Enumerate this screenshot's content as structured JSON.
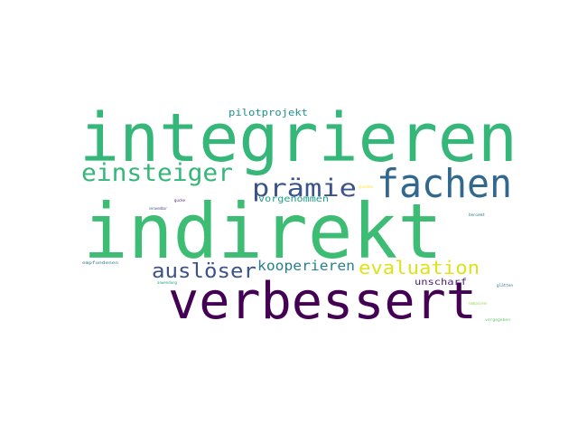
{
  "words": [
    {
      "id": "integrieren",
      "text": "integrieren",
      "color": "#35b779"
    },
    {
      "id": "indirekt",
      "text": "indirekt",
      "color": "#3dbc74"
    },
    {
      "id": "verbessert",
      "text": "verbessert",
      "color": "#440154"
    },
    {
      "id": "fachen",
      "text": "fachen",
      "color": "#31688e"
    },
    {
      "id": "einsteiger",
      "text": "einsteiger",
      "color": "#35b779"
    },
    {
      "id": "praemie",
      "text": "prämie",
      "color": "#3b528b"
    },
    {
      "id": "ausloeser",
      "text": "auslöser",
      "color": "#3b528b"
    },
    {
      "id": "evaluation",
      "text": "evaluation",
      "color": "#dde318"
    },
    {
      "id": "kooperieren",
      "text": "kooperieren",
      "color": "#26828e"
    },
    {
      "id": "pilotprojekt",
      "text": "pilotprojekt",
      "color": "#21918c"
    },
    {
      "id": "vorgenommen",
      "text": "vorgenommen",
      "color": "#1fa187"
    },
    {
      "id": "unscharf",
      "text": "unscharf",
      "color": "#482173"
    },
    {
      "id": "small-1",
      "text": "gleichen",
      "color": "#fde725"
    },
    {
      "id": "small-2",
      "text": "gucke",
      "color": "#481467"
    },
    {
      "id": "small-3",
      "text": "verwendbar",
      "color": "#3e4a89"
    },
    {
      "id": "small-4",
      "text": "benimmt",
      "color": "#277f8e"
    },
    {
      "id": "small-5",
      "text": "empfundenen",
      "color": "#2a788e"
    },
    {
      "id": "small-6",
      "text": "anwendung",
      "color": "#20a386"
    },
    {
      "id": "small-7",
      "text": "glätten",
      "color": "#2c728e"
    },
    {
      "id": "small-8",
      "text": "kombinieren",
      "color": "#8fd744"
    },
    {
      "id": "small-9",
      "text": "vorgegeben",
      "color": "#5ec962"
    }
  ]
}
